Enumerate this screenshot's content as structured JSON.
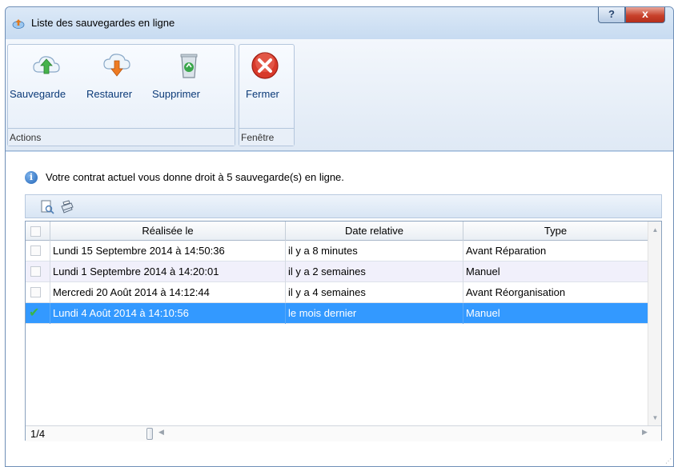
{
  "window": {
    "title": "Liste des sauvegardes en ligne",
    "help_label": "?",
    "close_label": "x"
  },
  "ribbon": {
    "groups": [
      {
        "label": "Actions",
        "buttons": [
          {
            "label": "Sauvegarde",
            "icon": "cloud-upload-icon"
          },
          {
            "label": "Restaurer",
            "icon": "cloud-download-icon"
          },
          {
            "label": "Supprimer",
            "icon": "recycle-bin-icon"
          }
        ]
      },
      {
        "label": "Fenêtre",
        "buttons": [
          {
            "label": "Fermer",
            "icon": "close-circle-icon"
          }
        ]
      }
    ]
  },
  "info": {
    "text": "Votre contrat actuel vous donne droit à 5 sauvegarde(s) en ligne."
  },
  "grid": {
    "columns": [
      "Réalisée le",
      "Date relative",
      "Type"
    ],
    "rows": [
      {
        "date": "Lundi 15 Septembre 2014 à 14:50:36",
        "relative": "il y a 8 minutes",
        "type": "Avant Réparation",
        "selected": false
      },
      {
        "date": "Lundi 1 Septembre 2014 à 14:20:01",
        "relative": "il y a 2 semaines",
        "type": "Manuel",
        "selected": false
      },
      {
        "date": "Mercredi 20 Août 2014 à 14:12:44",
        "relative": "il y a 4 semaines",
        "type": "Avant Réorganisation",
        "selected": false
      },
      {
        "date": "Lundi 4 Août 2014 à 14:10:56",
        "relative": "le mois dernier",
        "type": "Manuel",
        "selected": true
      }
    ],
    "pager": "1/4"
  },
  "colors": {
    "selection": "#3399ff",
    "close_red": "#c8412b",
    "frame": "#c6d9ee"
  }
}
